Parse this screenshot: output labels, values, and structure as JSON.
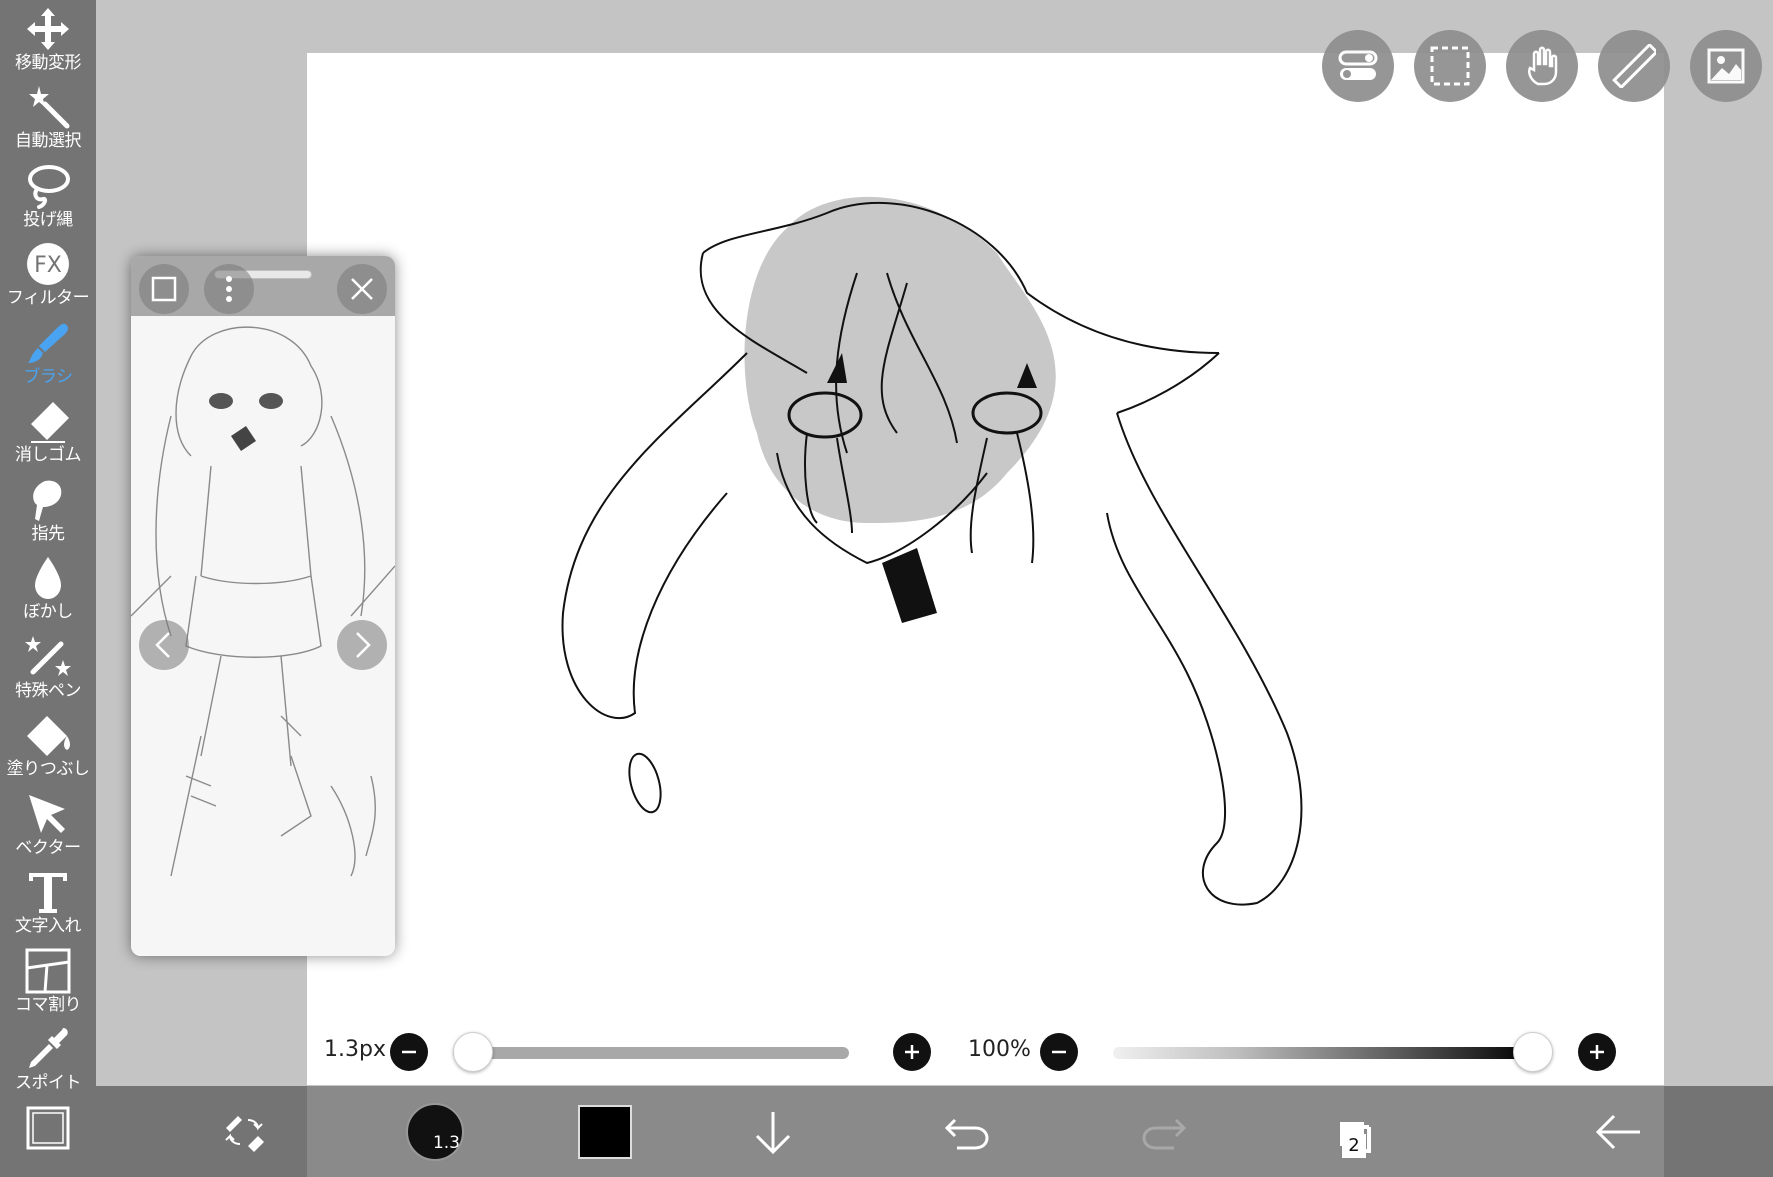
{
  "sidebar": {
    "items": [
      {
        "label": "移動変形",
        "icon": "move-icon"
      },
      {
        "label": "自動選択",
        "icon": "magic-wand-icon"
      },
      {
        "label": "投げ縄",
        "icon": "lasso-icon"
      },
      {
        "label": "フィルター",
        "icon": "fx-icon",
        "icon_text": "FX"
      },
      {
        "label": "ブラシ",
        "icon": "brush-icon",
        "active": true
      },
      {
        "label": "消しゴム",
        "icon": "eraser-icon"
      },
      {
        "label": "指先",
        "icon": "finger-icon"
      },
      {
        "label": "ぼかし",
        "icon": "blur-icon"
      },
      {
        "label": "特殊ペン",
        "icon": "special-pen-icon"
      },
      {
        "label": "塗りつぶし",
        "icon": "fill-icon"
      },
      {
        "label": "ベクター",
        "icon": "vector-icon"
      },
      {
        "label": "文字入れ",
        "icon": "text-icon"
      },
      {
        "label": "コマ割り",
        "icon": "frame-divider-icon"
      },
      {
        "label": "スポイト",
        "icon": "eyedropper-icon"
      },
      {
        "label": "",
        "icon": "canvas-icon"
      }
    ]
  },
  "top_buttons": [
    "toggle-icon",
    "selection-icon",
    "hand-icon",
    "ruler-icon",
    "material-icon"
  ],
  "reference_window": {
    "buttons": [
      "layer-icon",
      "more-icon",
      "close-icon",
      "prev-icon",
      "next-icon"
    ]
  },
  "brush_size": {
    "label": "1.3px",
    "fraction": 0.05
  },
  "opacity": {
    "label": "100%",
    "fraction": 1.0
  },
  "bottom_bar": {
    "brush_size_label": "1.3",
    "layer_count": "2",
    "color": "#000000"
  },
  "colors": {
    "accent": "#4aa3f0",
    "sidebar": "#747474",
    "bottom_inner": "#8a8a8a"
  }
}
